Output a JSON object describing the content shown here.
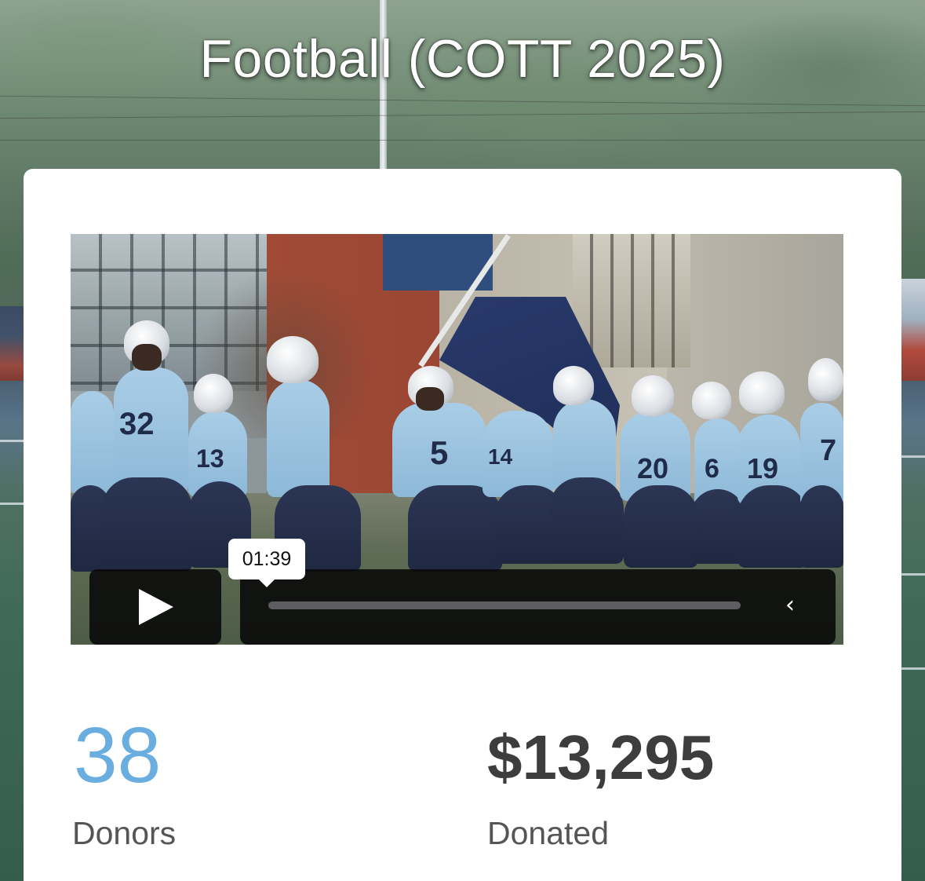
{
  "page": {
    "title": "Football (COTT 2025)"
  },
  "video": {
    "thumbnail_description_icon": "video-thumbnail",
    "time_tooltip": "01:39",
    "play_icon": "play-icon",
    "collapse_icon": "chevron-left-icon",
    "collapse_glyph": "‹",
    "jersey_numbers": [
      "32",
      "5",
      "20",
      "6",
      "19",
      "7",
      "14",
      "13"
    ]
  },
  "stats": {
    "donors": {
      "value": "38",
      "label": "Donors"
    },
    "donated": {
      "value": "$13,295",
      "label": "Donated"
    }
  },
  "colors": {
    "donors_accent": "#6aaee0",
    "donated_text": "#3d3d3d",
    "card_bg": "#ffffff"
  }
}
